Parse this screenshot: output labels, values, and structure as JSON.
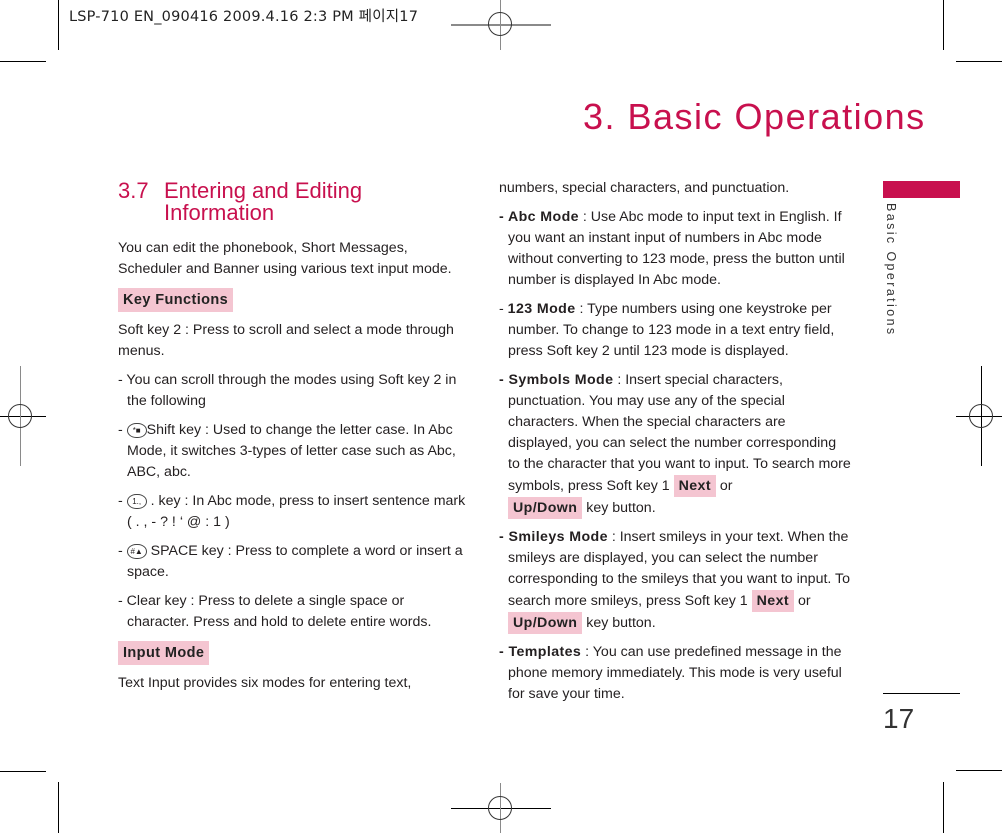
{
  "slug": {
    "text": "LSP-710 EN_090416  2009.4.16 2:3 PM  페이지17"
  },
  "chapter": {
    "title": "3. Basic Operations",
    "side_label": "Basic Operations",
    "page_number": "17",
    "accent_color": "#c8104e",
    "label_bg_color": "#f4c5d1"
  },
  "section": {
    "number": "3.7",
    "title_line1": "Entering and Editing",
    "title_line2": "Information",
    "intro": "You can edit the phonebook, Short Messages, Scheduler and Banner using various text input mode."
  },
  "key_functions": {
    "label": "Key Functions",
    "softkey2": "Soft key 2 : Press to scroll and select a mode through menus.",
    "items": [
      {
        "prefix": "- ",
        "icon": "",
        "text": "You can scroll through the modes using Soft key 2 in the following"
      },
      {
        "prefix": "- ",
        "icon": "*■",
        "icon_name": "star-shift-key-icon",
        "text": "Shift key : Used to change the letter case.  In Abc Mode, it switches 3-types of letter case such as Abc, ABC, abc."
      },
      {
        "prefix": "- ",
        "icon": "1.,",
        "icon_name": "one-key-icon",
        "text": " . key : In Abc mode, press to insert sentence mark ( .  ,  -  ?  !  ‘  @  :  1 )"
      },
      {
        "prefix": "- ",
        "icon": "#▲",
        "icon_name": "hash-space-key-icon",
        "text": " SPACE key : Press to complete a word or insert a space."
      },
      {
        "prefix": "- ",
        "icon": "",
        "text": "Clear key : Press to delete a single space or character. Press and hold to delete entire words."
      }
    ]
  },
  "input_mode": {
    "label": "Input Mode",
    "intro_part1": "Text Input provides six modes for entering text,",
    "intro_part2": "numbers, special characters, and punctuation.",
    "modes": [
      {
        "name": "Abc Mode",
        "desc": " : Use Abc mode to input text in English. If you want an instant input of numbers in Abc mode without converting to 123 mode, press the button until number is displayed In Abc mode."
      },
      {
        "name": "123 Mode",
        "desc": " : Type numbers using one keystroke per number. To change to 123 mode in a text entry field, press Soft key 2 until 123 mode is displayed."
      },
      {
        "name": "Symbols Mode",
        "desc": " : Insert special characters, punctuation. You may use any of the special characters. When the special characters are displayed, you can select the number corresponding to the character that you want to input. To search more symbols, press Soft key 1 ",
        "btn1": "Next",
        "mid": " or ",
        "btn2": "Up/Down",
        "tail": " key button."
      },
      {
        "name": "Smileys Mode",
        "desc": " : Insert smileys in your text. When the smileys are displayed, you can select the number corresponding to the smileys that you want to input. To search more smileys, press Soft key 1 ",
        "btn1": "Next",
        "mid": " or ",
        "btn2": "Up/Down",
        "tail": " key button."
      },
      {
        "name": "Templates",
        "desc": " : You can use predefined message in the phone memory immediately. This mode is very useful for save your time."
      }
    ]
  }
}
